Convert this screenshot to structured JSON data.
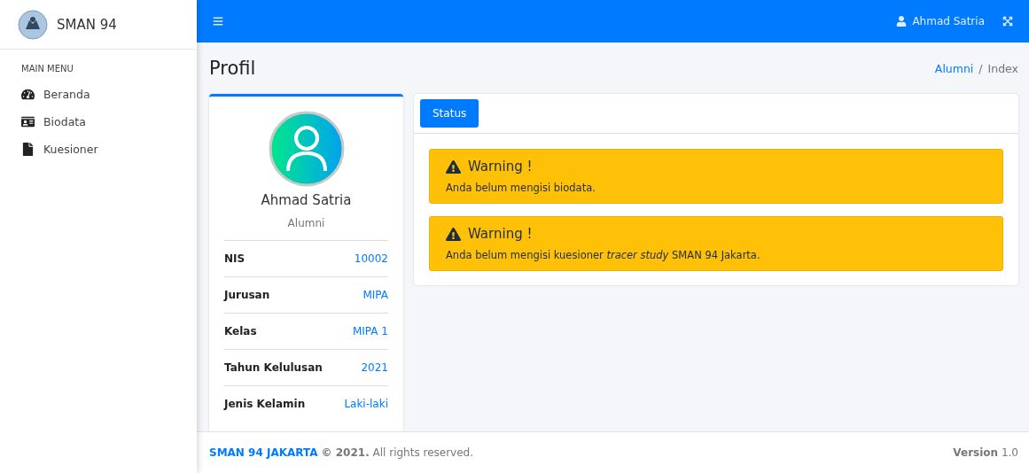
{
  "sidebar": {
    "brand": "SMAN 94",
    "section": "MAIN MENU",
    "items": [
      {
        "label": "Beranda"
      },
      {
        "label": "Biodata"
      },
      {
        "label": "Kuesioner"
      }
    ]
  },
  "navbar": {
    "user": "Ahmad Satria"
  },
  "page": {
    "title": "Profil",
    "breadcrumb": [
      "Alumni",
      "/",
      "Index"
    ]
  },
  "profile": {
    "name": "Ahmad Satria",
    "role": "Alumni",
    "fields": [
      {
        "label": "NIS",
        "value": "10002"
      },
      {
        "label": "Jurusan",
        "value": "MIPA"
      },
      {
        "label": "Kelas",
        "value": "MIPA 1"
      },
      {
        "label": "Tahun Kelulusan",
        "value": "2021"
      },
      {
        "label": "Jenis Kelamin",
        "value": "Laki-laki"
      }
    ]
  },
  "tabs": [
    {
      "label": "Status",
      "selected": true
    }
  ],
  "alerts": [
    {
      "title": "Warning !",
      "message": "Anda belum mengisi biodata."
    },
    {
      "title": "Warning !",
      "message": "Anda belum mengisi kuesioner *tracer study* SMAN 94 Jakarta."
    }
  ],
  "footer": {
    "brand": "SMAN 94 JAKARTA",
    "text": "**© 2021.** All rights reserved.",
    "version": "**Version** 1.0"
  }
}
